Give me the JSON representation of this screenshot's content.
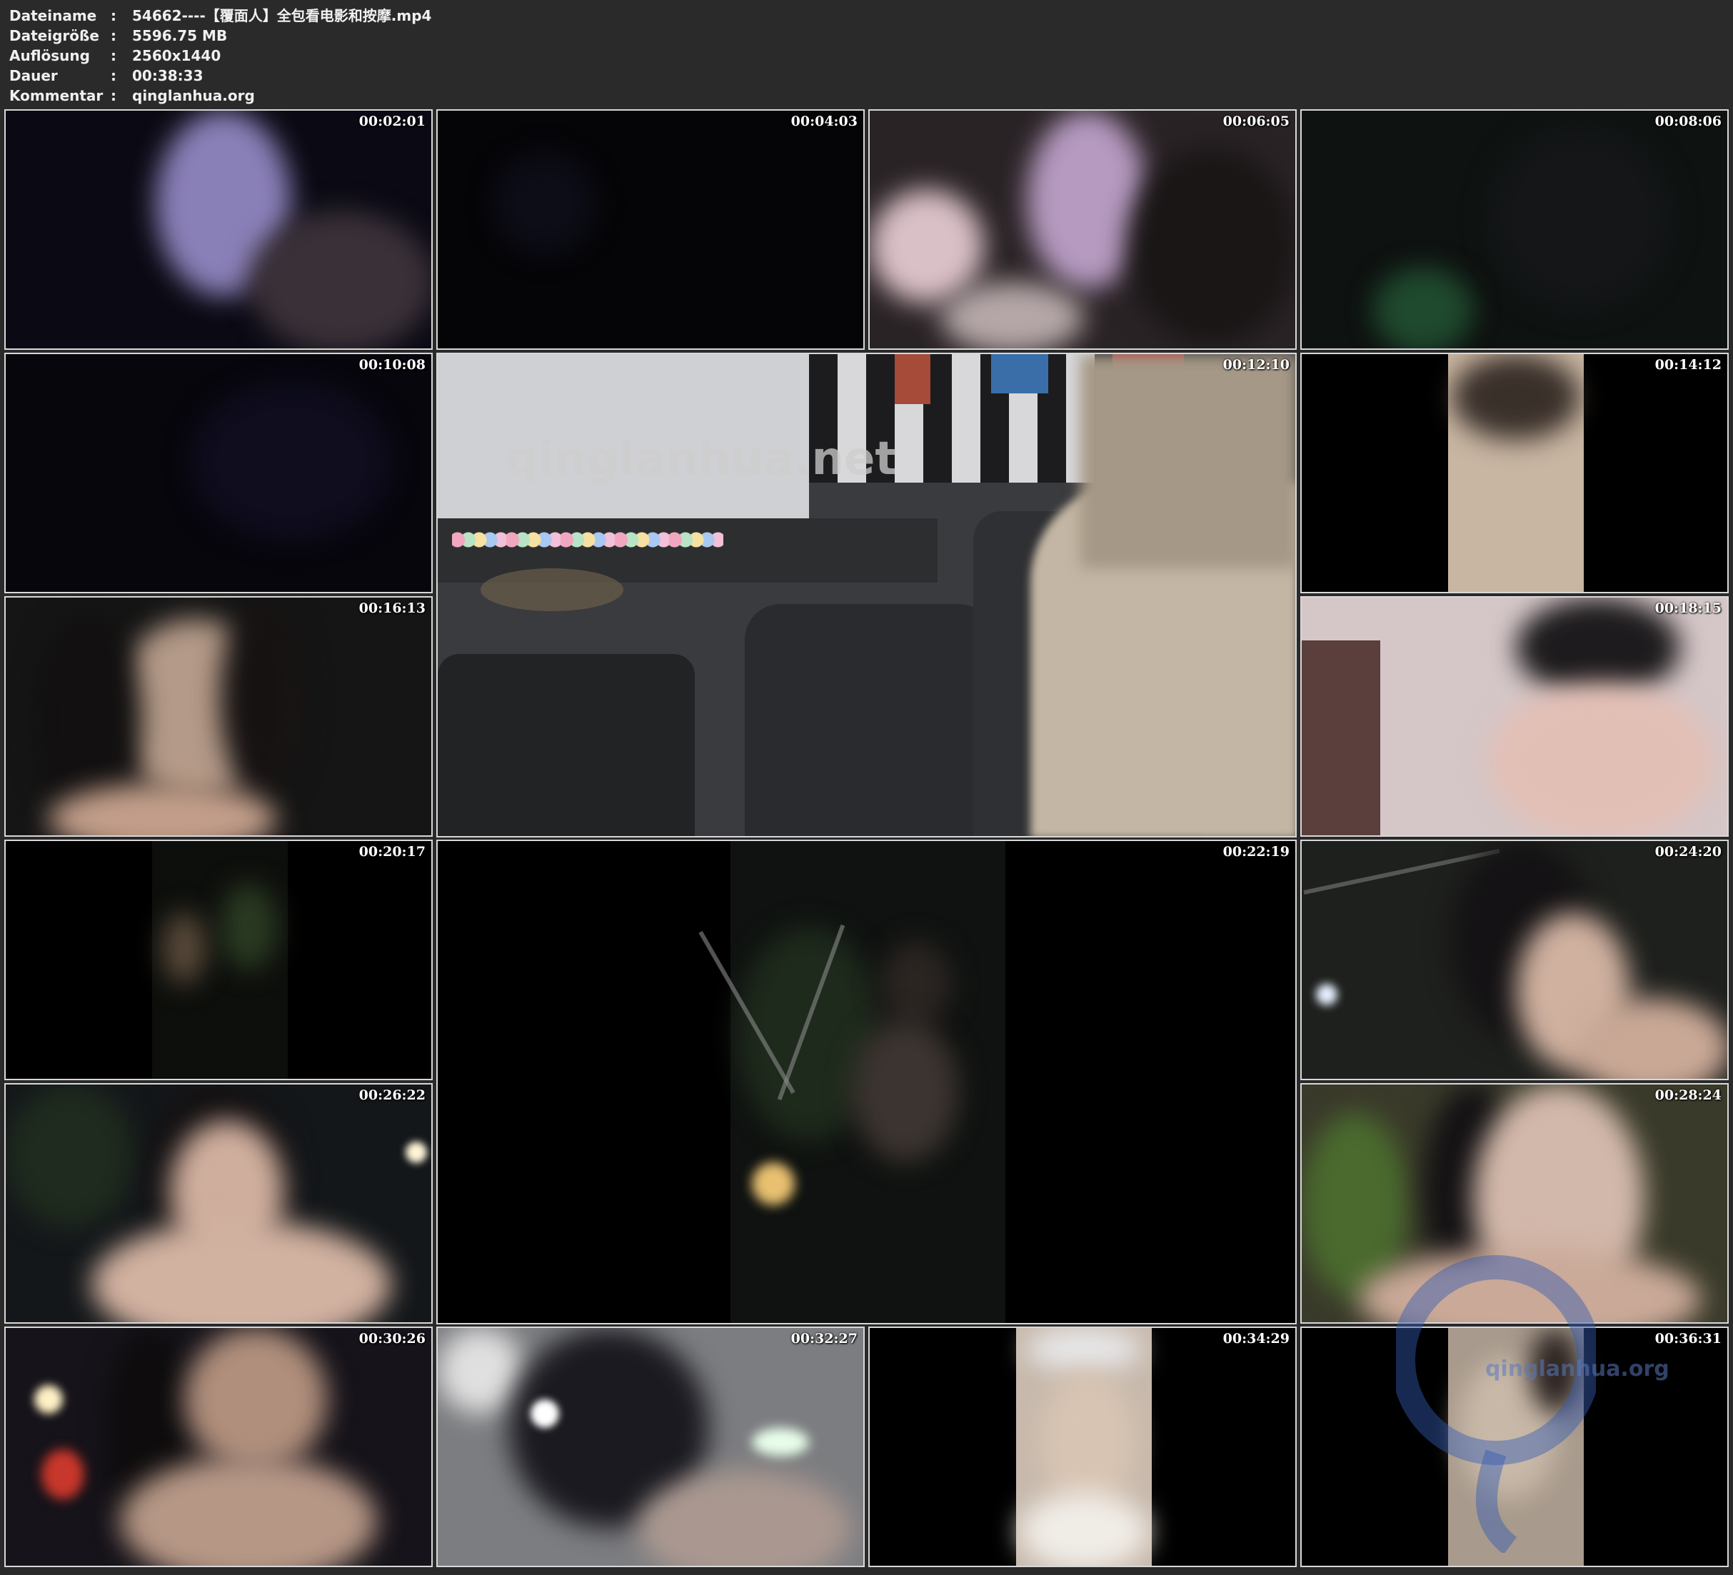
{
  "metadata": [
    {
      "key": "Dateiname",
      "value": "54662----【覆面人】全包看电影和按摩.mp4"
    },
    {
      "key": "Dateigröße",
      "value": "5596.75 MB"
    },
    {
      "key": "Auflösung",
      "value": "2560x1440"
    },
    {
      "key": "Dauer",
      "value": "00:38:33"
    },
    {
      "key": "Kommentar",
      "value": "qinglanhua.org"
    }
  ],
  "separator": ":",
  "thumbnails": [
    {
      "timestamp": "00:02:01"
    },
    {
      "timestamp": "00:04:03"
    },
    {
      "timestamp": "00:06:05"
    },
    {
      "timestamp": "00:08:06"
    },
    {
      "timestamp": "00:10:08"
    },
    {
      "timestamp": "00:12:10"
    },
    {
      "timestamp": "00:14:12"
    },
    {
      "timestamp": "00:16:13"
    },
    {
      "timestamp": "00:18:15"
    },
    {
      "timestamp": "00:20:17"
    },
    {
      "timestamp": "00:22:19"
    },
    {
      "timestamp": "00:24:20"
    },
    {
      "timestamp": "00:26:22"
    },
    {
      "timestamp": "00:28:24"
    },
    {
      "timestamp": "00:30:26"
    },
    {
      "timestamp": "00:32:27"
    },
    {
      "timestamp": "00:34:29"
    },
    {
      "timestamp": "00:36:31"
    }
  ],
  "watermarks": {
    "large_text": "qinglanhua.net",
    "logo_text": "qinglanhua.org"
  }
}
